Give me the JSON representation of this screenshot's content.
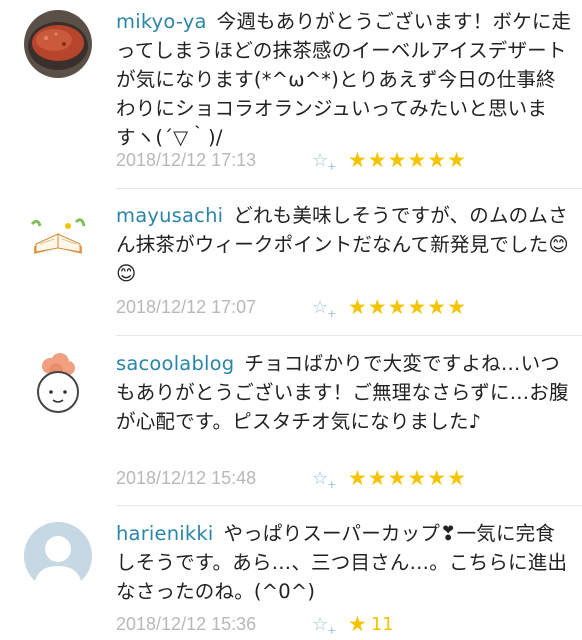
{
  "comments": [
    {
      "username": "mikyo-ya",
      "text": "今週もありがとうございます！ボケに走ってしまうほどの抹茶感のイーベルアイスデザートが気になります(*^ω^*)とりあえず今日の仕事終わりにショコラオランジュいってみたいと思いますヽ(´▽｀)/",
      "timestamp": "2018/12/12 17:13",
      "stars": "★★★★★★",
      "star_count": ""
    },
    {
      "username": "mayusachi",
      "text": "どれも美味しそうですが、のムのムさん抹茶がウィークポイントだなんて新発見でした😊😊",
      "timestamp": "2018/12/12 17:07",
      "stars": "★★★★★★",
      "star_count": ""
    },
    {
      "username": "sacoolablog",
      "text": "チョコばかりで大変ですよね…いつもありがとうございます！ご無理なさらずに…お腹が心配です。ピスタチオ気になりました♪",
      "timestamp": "2018/12/12 15:48",
      "stars": "★★★★★★",
      "star_count": ""
    },
    {
      "username": "harienikki",
      "text": "やっぱりスーパーカップ❣一気に完食しそうです。あら…、三つ目さん…。こちらに進出なさったのね。(^0^)",
      "timestamp": "2018/12/12 15:36",
      "stars": "★",
      "star_count": "11"
    }
  ],
  "icons": {
    "add_star": "☆",
    "add_star_plus": "+"
  },
  "colors": {
    "username": "#2a86a8",
    "star": "#f5c400",
    "timestamp": "#b8b8b8",
    "add_star": "#9cc1de"
  }
}
